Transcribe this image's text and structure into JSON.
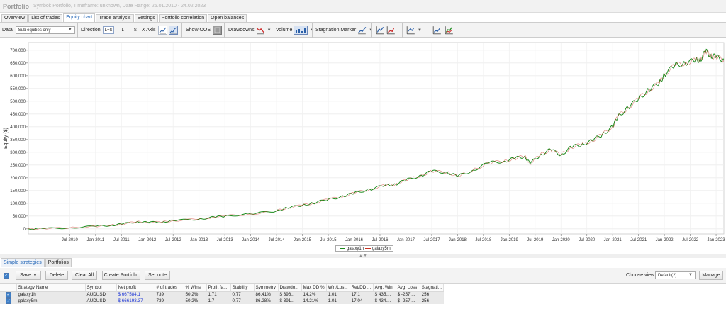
{
  "window": {
    "title": "Portfolio",
    "subtitle": "Symbol: Portfolio, Timeframe: unknown, Date Range: 25.01.2010 - 24.02.2023"
  },
  "tabs": [
    "Overview",
    "List of trades",
    "Equity chart",
    "Trade analysis",
    "Settings",
    "Portfolio correlation",
    "Open balances"
  ],
  "active_tab": "Equity chart",
  "toolbar": {
    "data_label": "Data",
    "data_select": "Sub equities only",
    "direction_label": "Direction",
    "direction_options": [
      "L+S",
      "L",
      "S"
    ],
    "direction_selected": "L+S",
    "xaxis_label": "X Axis",
    "show_oos_label": "Show OOS",
    "drawdowns_label": "Drawdowns",
    "volume_label": "Volume",
    "stagnation_label": "Stagnation Marker",
    "icons": [
      "xaxis-date-icon",
      "xaxis-trades-icon",
      "oos-toggle-icon",
      "drawdowns-icon",
      "volume-icon",
      "stagnation-icon",
      "chart-type-1-icon",
      "chart-type-2-icon",
      "chart-type-3-icon",
      "chart-type-4-icon",
      "chart-type-5-icon"
    ]
  },
  "chart_data": {
    "type": "line",
    "ylabel": "Equity ($)",
    "xlabel": "",
    "ylim": [
      -20000,
      730000
    ],
    "yticks": [
      0,
      50000,
      100000,
      150000,
      200000,
      250000,
      300000,
      350000,
      400000,
      450000,
      500000,
      550000,
      600000,
      650000,
      700000
    ],
    "ytick_labels": [
      "0",
      "50,000",
      "100,000",
      "150,000",
      "200,000",
      "250,000",
      "300,000",
      "350,000",
      "400,000",
      "450,000",
      "500,000",
      "550,000",
      "600,000",
      "650,000",
      "700,000"
    ],
    "xlim": [
      2009.7,
      2023.15
    ],
    "xticks": [
      2010.5,
      2011,
      2011.5,
      2012,
      2012.5,
      2013,
      2013.5,
      2014,
      2014.5,
      2015,
      2015.5,
      2016,
      2016.5,
      2017,
      2017.5,
      2018,
      2018.5,
      2019,
      2019.5,
      2020,
      2020.5,
      2021,
      2021.5,
      2022,
      2022.5,
      2023
    ],
    "xtick_labels": [
      "Jul-2010",
      "Jan-2011",
      "Jul-2011",
      "Jan-2012",
      "Jul-2012",
      "Jan-2013",
      "Jul-2013",
      "Jan-2014",
      "Jul-2014",
      "Jan-2015",
      "Jul-2015",
      "Jan-2016",
      "Jul-2016",
      "Jan-2017",
      "Jul-2017",
      "Jan-2018",
      "Jul-2018",
      "Jan-2019",
      "Jul-2019",
      "Jan-2020",
      "Jul-2020",
      "Jan-2021",
      "Jul-2021",
      "Jan-2022",
      "Jul-2022",
      "Jan-2023"
    ],
    "grid": true,
    "legend_position": "bottom-center",
    "series": [
      {
        "name": "galaxy1h",
        "color": "#1a8a1a",
        "x": [
          2009.7,
          2010.0,
          2010.5,
          2011.0,
          2011.3,
          2011.5,
          2011.8,
          2012.0,
          2012.3,
          2012.5,
          2013.0,
          2013.3,
          2013.5,
          2014.0,
          2014.5,
          2014.7,
          2015.0,
          2015.2,
          2015.5,
          2015.8,
          2016.0,
          2016.3,
          2016.6,
          2016.8,
          2017.0,
          2017.3,
          2017.5,
          2017.8,
          2018.0,
          2018.3,
          2018.6,
          2018.9,
          2019.1,
          2019.3,
          2019.4,
          2019.6,
          2019.8,
          2020.0,
          2020.2,
          2020.4,
          2020.6,
          2020.8,
          2021.0,
          2021.1,
          2021.3,
          2021.5,
          2021.7,
          2021.9,
          2022.0,
          2022.2,
          2022.4,
          2022.6,
          2022.7,
          2022.8,
          2022.9,
          2023.0,
          2023.15
        ],
        "y": [
          0,
          1000,
          4000,
          10000,
          14000,
          18000,
          28000,
          25000,
          27000,
          32000,
          38000,
          46000,
          50000,
          58000,
          70000,
          82000,
          92000,
          100000,
          115000,
          128000,
          140000,
          155000,
          170000,
          175000,
          190000,
          210000,
          225000,
          222000,
          205000,
          230000,
          258000,
          265000,
          275000,
          285000,
          255000,
          290000,
          310000,
          290000,
          320000,
          330000,
          345000,
          370000,
          400000,
          440000,
          475000,
          510000,
          545000,
          570000,
          605000,
          640000,
          650000,
          660000,
          665000,
          695000,
          680000,
          672000,
          665000
        ]
      },
      {
        "name": "galaxy5m",
        "color": "#c8301f",
        "x": [
          2009.7,
          2010.0,
          2010.5,
          2011.0,
          2011.3,
          2011.5,
          2011.8,
          2012.0,
          2012.3,
          2012.5,
          2013.0,
          2013.3,
          2013.5,
          2014.0,
          2014.5,
          2014.7,
          2015.0,
          2015.2,
          2015.5,
          2015.8,
          2016.0,
          2016.3,
          2016.6,
          2016.8,
          2017.0,
          2017.3,
          2017.5,
          2017.8,
          2018.0,
          2018.3,
          2018.6,
          2018.9,
          2019.1,
          2019.3,
          2019.4,
          2019.6,
          2019.8,
          2020.0,
          2020.2,
          2020.4,
          2020.6,
          2020.8,
          2021.0,
          2021.1,
          2021.3,
          2021.5,
          2021.7,
          2021.9,
          2022.0,
          2022.2,
          2022.4,
          2022.6,
          2022.7,
          2022.8,
          2022.9,
          2023.0,
          2023.15
        ],
        "y": [
          0,
          1000,
          4000,
          10000,
          14000,
          18000,
          28000,
          25000,
          27000,
          32000,
          38000,
          46000,
          50000,
          58000,
          70000,
          82000,
          92000,
          100000,
          115000,
          128000,
          140000,
          155000,
          170000,
          175000,
          190000,
          210000,
          225000,
          222000,
          205000,
          230000,
          258000,
          265000,
          275000,
          285000,
          255000,
          290000,
          310000,
          290000,
          320000,
          330000,
          345000,
          370000,
          400000,
          440000,
          475000,
          510000,
          545000,
          570000,
          605000,
          640000,
          650000,
          660000,
          665000,
          693000,
          679000,
          671000,
          664000
        ]
      }
    ]
  },
  "splitter_arrows": "▲   ▼",
  "bottom_tabs": [
    "Simple strategies",
    "Portfolios"
  ],
  "bottom_active_tab": "Simple strategies",
  "actions": {
    "save": "Save",
    "save_arrow": "▼",
    "delete": "Delete",
    "clear_all": "Clear All",
    "create_portfolio": "Create Portfolio",
    "set_note": "Set note",
    "choose_view_label": "Choose view",
    "choose_view_value": "Default(2)",
    "manage": "Manage"
  },
  "table": {
    "columns": [
      "Strategy Name",
      "Symbol",
      "Net profit",
      "# of trades",
      "% Wins",
      "Profit fa...",
      "Stability",
      "Symmetry",
      "Drawdo...",
      "Max DD %",
      "Win/Los...",
      "Ret/DD ...",
      "Avg. Win",
      "Avg. Loss",
      "Stagnati..."
    ],
    "rows": [
      [
        "galaxy1h",
        "AUDUSD",
        "$ 667584.1",
        "739",
        "50.2%",
        "1.71",
        "0.77",
        "86.41%",
        "$ 396...",
        "14.2%",
        "1.01",
        "17.1",
        "$ 435....",
        "$ -257....",
        "256"
      ],
      [
        "galaxy5m",
        "AUDUSD",
        "$ 666193.37",
        "739",
        "50.2%",
        "1.7",
        "0.77",
        "86.28%",
        "$ 391...",
        "14.21%",
        "1.01",
        "17.04",
        "$ 434....",
        "$ -257....",
        "256"
      ]
    ]
  }
}
